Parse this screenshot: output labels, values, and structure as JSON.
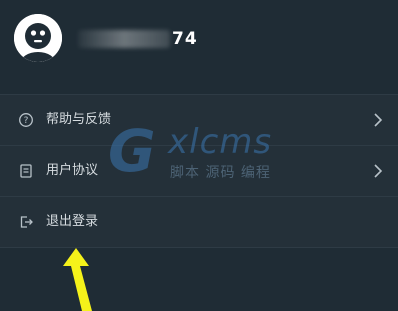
{
  "profile": {
    "username_suffix": "74"
  },
  "menu": {
    "items": [
      {
        "label": "帮助与反馈",
        "icon": "help-circle-icon",
        "has_chevron": true
      },
      {
        "label": "用户协议",
        "icon": "document-icon",
        "has_chevron": true
      },
      {
        "label": "退出登录",
        "icon": "logout-icon",
        "has_chevron": false
      }
    ]
  },
  "watermark": {
    "g": "G",
    "brand": "xlcms",
    "sub": "脚本 源码 编程"
  },
  "colors": {
    "background": "#1f2c35",
    "menu_background": "#243039",
    "divider": "#2e3b45",
    "text": "#d6dce0",
    "annotation_arrow": "#f5f21a"
  }
}
